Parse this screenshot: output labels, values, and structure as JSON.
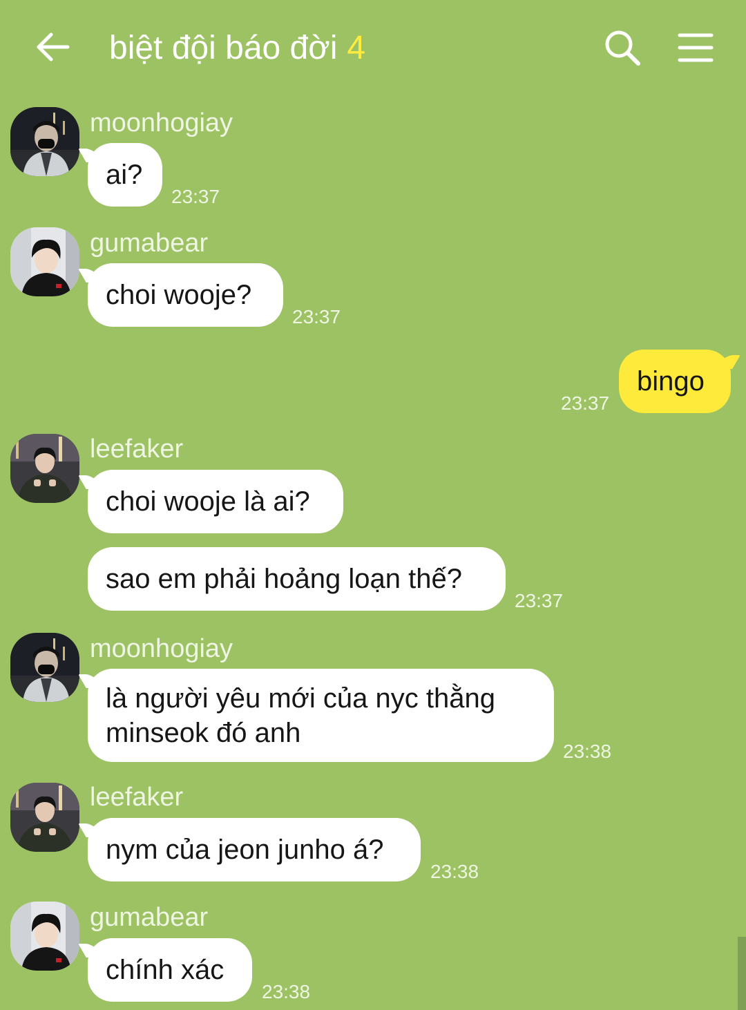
{
  "header": {
    "title": "biệt đội báo đời",
    "member_count": "4",
    "icons": {
      "back": "arrow-left-icon",
      "search": "search-icon",
      "menu": "hamburger-menu-icon"
    }
  },
  "colors": {
    "background": "#9dc264",
    "incoming_bubble": "#ffffff",
    "outgoing_bubble": "#fdea3a",
    "member_count_accent": "#ffec3d",
    "meta_text": "#eef5e2"
  },
  "messages": [
    {
      "sender": "moonhogiay",
      "text": "ai?",
      "time": "23:37"
    },
    {
      "sender": "gumabear",
      "text": "choi wooje?",
      "time": "23:37"
    },
    {
      "sender": "me",
      "text": "bingo",
      "time": "23:37"
    },
    {
      "sender": "leefaker",
      "text": "choi wooje là ai?",
      "time": ""
    },
    {
      "sender": "leefaker",
      "text": "sao em phải hoảng loạn thế?",
      "time": "23:37"
    },
    {
      "sender": "moonhogiay",
      "text": "là người yêu mới của nyc thằng minseok đó anh",
      "time": "23:38"
    },
    {
      "sender": "leefaker",
      "text": "nym của jeon junho á?",
      "time": "23:38"
    },
    {
      "sender": "gumabear",
      "text": "chính xác",
      "time": "23:38"
    }
  ]
}
